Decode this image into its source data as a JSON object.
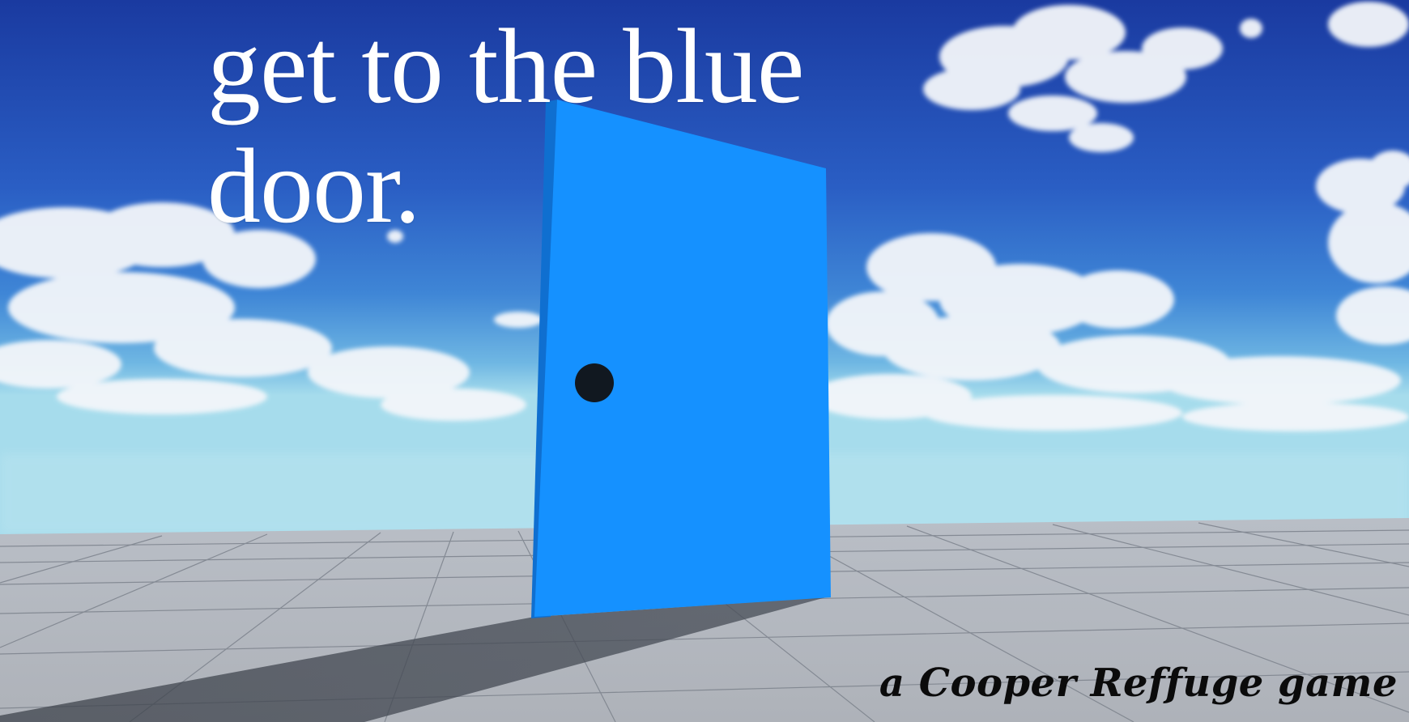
{
  "title": {
    "line1": "get to the blue",
    "line2": "door."
  },
  "credit": "a Cooper Reffuge game",
  "colors": {
    "sky_top": "#1a3fa8",
    "sky_horizon": "#9fd8ea",
    "door": "#1591ff",
    "door_side": "#0f6fd0",
    "doorknob": "#111820",
    "floor": "#a9adb4",
    "title_text": "#ffffff",
    "credit_text": "#0b0b0b"
  },
  "icons": {
    "door": "blue-door",
    "doorknob": "doorknob"
  }
}
